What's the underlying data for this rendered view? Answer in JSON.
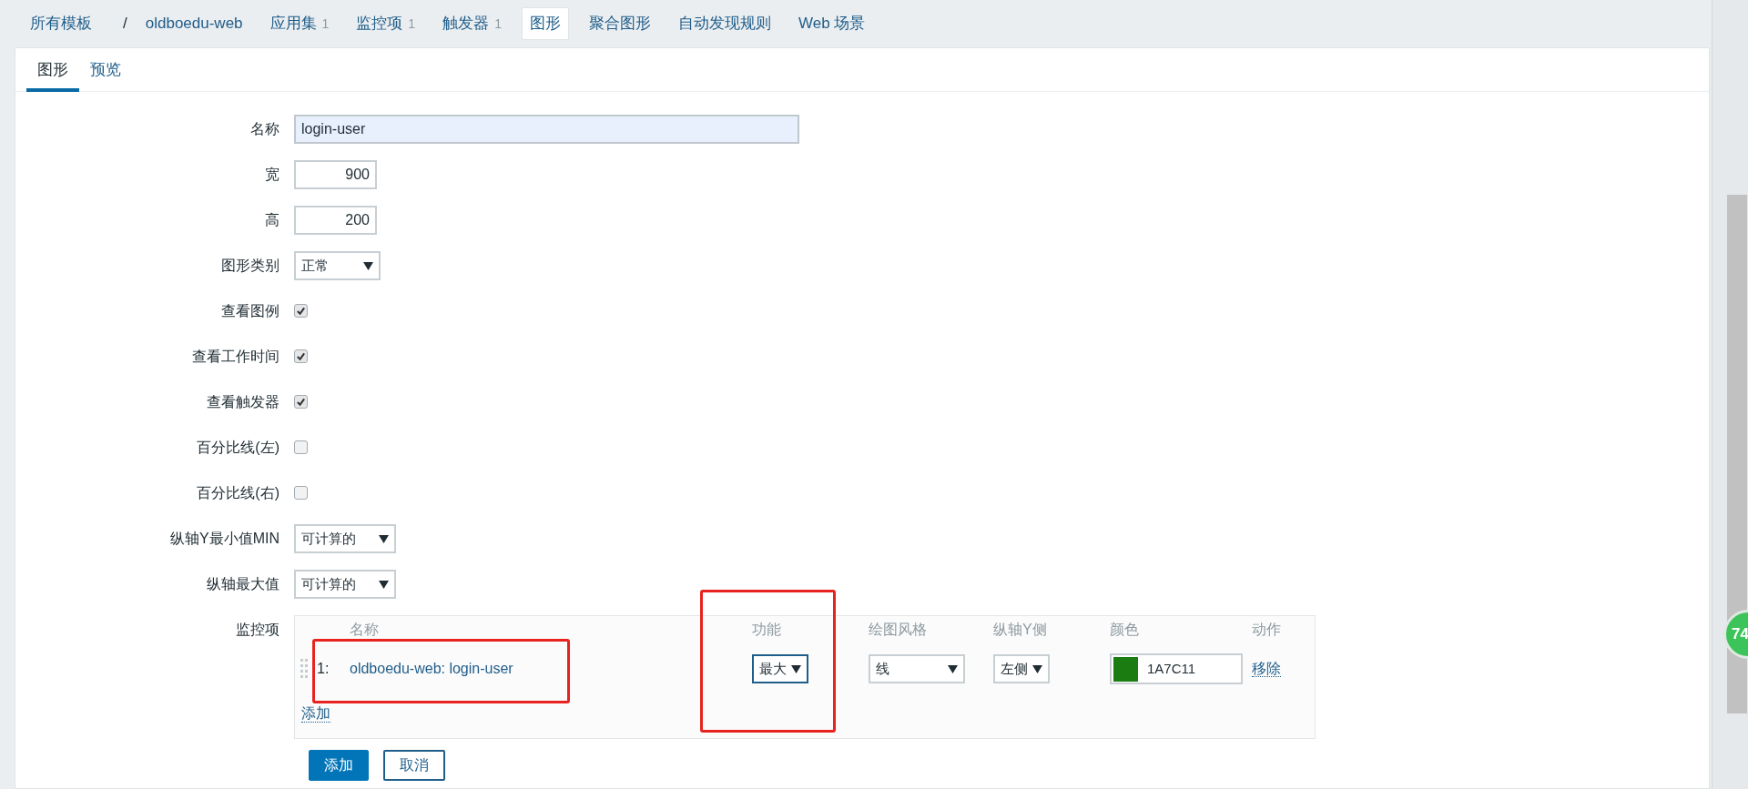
{
  "nav": [
    {
      "label": "所有模板",
      "kind": "link",
      "selected": false
    },
    {
      "label": "/",
      "kind": "separator"
    },
    {
      "label": "oldboedu-web",
      "kind": "link",
      "selected": false
    },
    {
      "label": "应用集",
      "count": "1",
      "kind": "link",
      "selected": false
    },
    {
      "label": "监控项",
      "count": "1",
      "kind": "link",
      "selected": false
    },
    {
      "label": "触发器",
      "count": "1",
      "kind": "link",
      "selected": false
    },
    {
      "label": "图形",
      "kind": "link",
      "selected": true
    },
    {
      "label": "聚合图形",
      "kind": "link",
      "selected": false
    },
    {
      "label": "自动发现规则",
      "kind": "link",
      "selected": false
    },
    {
      "label": "Web 场景",
      "kind": "link",
      "selected": false
    }
  ],
  "tabs": [
    {
      "label": "图形",
      "selected": true
    },
    {
      "label": "预览",
      "selected": false
    }
  ],
  "fields": [
    {
      "label": "名称",
      "kind": "text",
      "value": "login-user"
    },
    {
      "label": "宽",
      "kind": "number",
      "value": "900"
    },
    {
      "label": "高",
      "kind": "number",
      "value": "200"
    },
    {
      "label": "图形类别",
      "kind": "select",
      "value": "正常"
    },
    {
      "label": "查看图例",
      "kind": "checkbox",
      "checked": true
    },
    {
      "label": "查看工作时间",
      "kind": "checkbox",
      "checked": true
    },
    {
      "label": "查看触发器",
      "kind": "checkbox",
      "checked": true
    },
    {
      "label": "百分比线(左)",
      "kind": "checkbox",
      "checked": false
    },
    {
      "label": "百分比线(右)",
      "kind": "checkbox",
      "checked": false
    },
    {
      "label": "纵轴Y最小值MIN",
      "kind": "select",
      "value": "可计算的"
    },
    {
      "label": "纵轴最大值",
      "kind": "select",
      "value": "可计算的"
    }
  ],
  "items": {
    "label": "监控项",
    "columns": [
      "名称",
      "功能",
      "绘图风格",
      "纵轴Y侧",
      "颜色",
      "动作"
    ],
    "rows": [
      {
        "number": "1:",
        "name": "oldboedu-web: login-user",
        "function": "最大",
        "style": "线",
        "y_side": "左侧",
        "color": "#1a7c11",
        "color_text": "1A7C11",
        "action": "移除"
      }
    ],
    "add_link": "添加"
  },
  "buttons": [
    {
      "label": "添加",
      "kind": "primary"
    },
    {
      "label": "取消",
      "kind": "secondary"
    }
  ],
  "widget": {
    "text": "74"
  }
}
